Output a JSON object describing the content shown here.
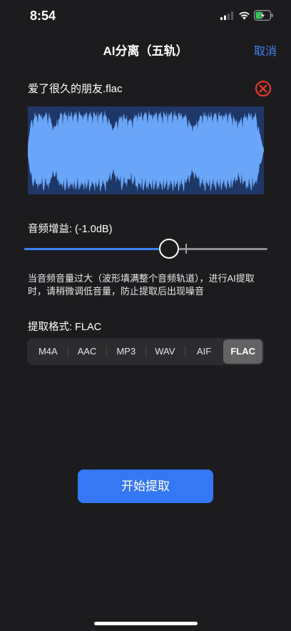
{
  "status_bar": {
    "time": "8:54",
    "icons": [
      "signal-icon",
      "wifi-icon",
      "battery-charging-icon"
    ]
  },
  "nav": {
    "title": "AI分离（五轨）",
    "cancel_label": "取消"
  },
  "file": {
    "name": "爱了很久的朋友.flac",
    "remove_icon": "close-circle-icon"
  },
  "waveform": {
    "color": "#6aa6f8",
    "background": "#1f3766"
  },
  "gain": {
    "label": "音频增益: (-1.0dB)",
    "value_fraction": 0.595,
    "zero_mark_fraction": 0.665,
    "fill_color": "#3b82f6"
  },
  "hint": "当音频音量过大（波形填满整个音频轨道），进行AI提取时，请稍微调低音量，防止提取后出现噪音",
  "format": {
    "label": "提取格式: FLAC",
    "options": [
      "M4A",
      "AAC",
      "MP3",
      "WAV",
      "AIF",
      "FLAC"
    ],
    "selected": "FLAC"
  },
  "start_button": {
    "label": "开始提取",
    "color": "#3478f6"
  },
  "accent_color": "#3b82f6",
  "danger_color": "#e0392b"
}
